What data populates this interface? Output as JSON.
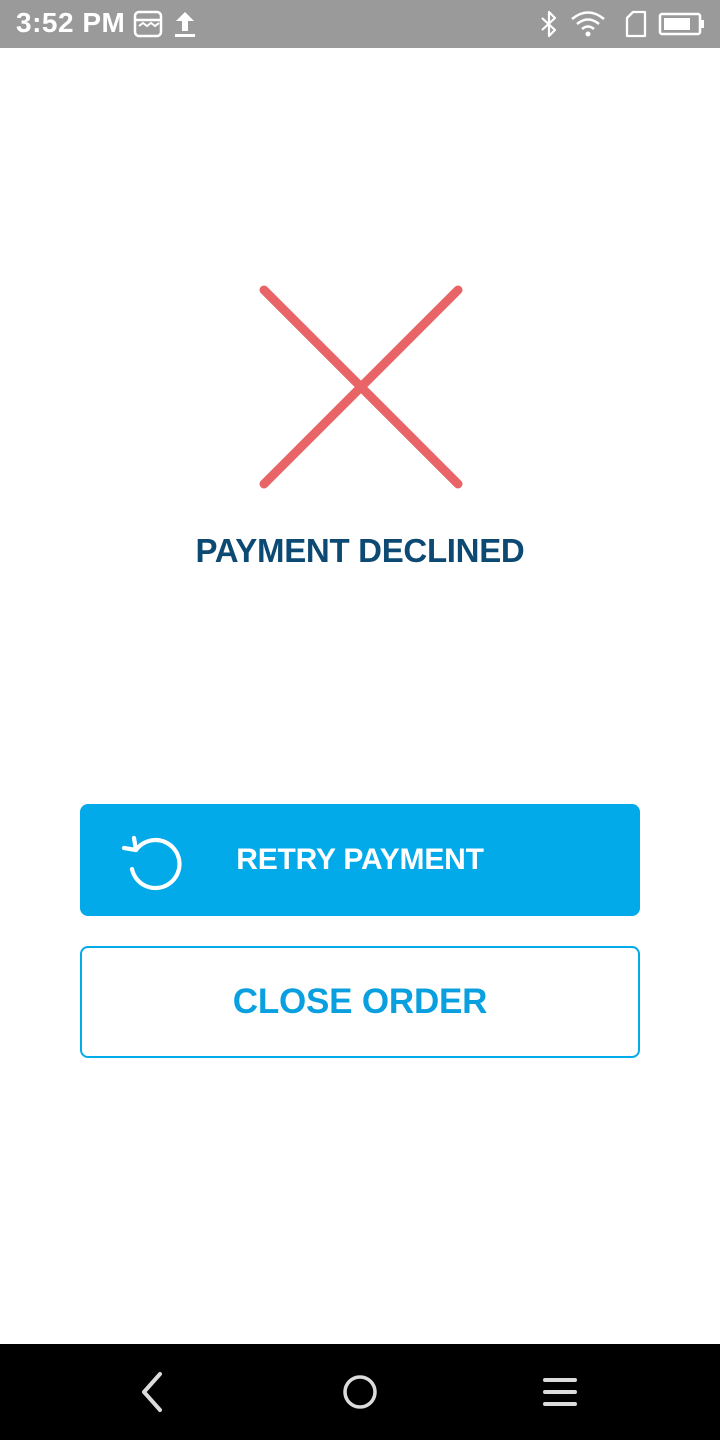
{
  "status_bar": {
    "time": "3:52 PM",
    "icons": [
      "store-icon",
      "upload-icon",
      "bluetooth-icon",
      "wifi-icon",
      "sim-card-icon",
      "battery-icon"
    ]
  },
  "result": {
    "icon": "declined-x-icon",
    "title": "PAYMENT DECLINED"
  },
  "actions": {
    "retry_label": "RETRY PAYMENT",
    "retry_icon": "retry-icon",
    "close_label": "CLOSE ORDER"
  },
  "nav_bar": {
    "icons": [
      "back-icon",
      "home-icon",
      "menu-icon"
    ]
  },
  "colors": {
    "status_bar": "#9a9a9a",
    "decline_red": "#e86467",
    "title_navy": "#0d4a73",
    "accent_blue": "#03aaea",
    "nav_bar": "#000000"
  }
}
